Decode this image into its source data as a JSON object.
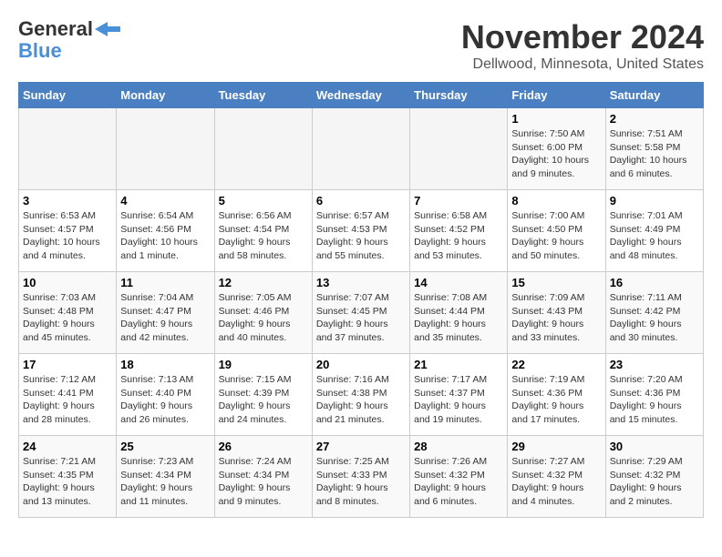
{
  "header": {
    "logo_line1": "General",
    "logo_line2": "Blue",
    "month": "November 2024",
    "location": "Dellwood, Minnesota, United States"
  },
  "days_of_week": [
    "Sunday",
    "Monday",
    "Tuesday",
    "Wednesday",
    "Thursday",
    "Friday",
    "Saturday"
  ],
  "weeks": [
    [
      {
        "day": "",
        "info": ""
      },
      {
        "day": "",
        "info": ""
      },
      {
        "day": "",
        "info": ""
      },
      {
        "day": "",
        "info": ""
      },
      {
        "day": "",
        "info": ""
      },
      {
        "day": "1",
        "info": "Sunrise: 7:50 AM\nSunset: 6:00 PM\nDaylight: 10 hours and 9 minutes."
      },
      {
        "day": "2",
        "info": "Sunrise: 7:51 AM\nSunset: 5:58 PM\nDaylight: 10 hours and 6 minutes."
      }
    ],
    [
      {
        "day": "3",
        "info": "Sunrise: 6:53 AM\nSunset: 4:57 PM\nDaylight: 10 hours and 4 minutes."
      },
      {
        "day": "4",
        "info": "Sunrise: 6:54 AM\nSunset: 4:56 PM\nDaylight: 10 hours and 1 minute."
      },
      {
        "day": "5",
        "info": "Sunrise: 6:56 AM\nSunset: 4:54 PM\nDaylight: 9 hours and 58 minutes."
      },
      {
        "day": "6",
        "info": "Sunrise: 6:57 AM\nSunset: 4:53 PM\nDaylight: 9 hours and 55 minutes."
      },
      {
        "day": "7",
        "info": "Sunrise: 6:58 AM\nSunset: 4:52 PM\nDaylight: 9 hours and 53 minutes."
      },
      {
        "day": "8",
        "info": "Sunrise: 7:00 AM\nSunset: 4:50 PM\nDaylight: 9 hours and 50 minutes."
      },
      {
        "day": "9",
        "info": "Sunrise: 7:01 AM\nSunset: 4:49 PM\nDaylight: 9 hours and 48 minutes."
      }
    ],
    [
      {
        "day": "10",
        "info": "Sunrise: 7:03 AM\nSunset: 4:48 PM\nDaylight: 9 hours and 45 minutes."
      },
      {
        "day": "11",
        "info": "Sunrise: 7:04 AM\nSunset: 4:47 PM\nDaylight: 9 hours and 42 minutes."
      },
      {
        "day": "12",
        "info": "Sunrise: 7:05 AM\nSunset: 4:46 PM\nDaylight: 9 hours and 40 minutes."
      },
      {
        "day": "13",
        "info": "Sunrise: 7:07 AM\nSunset: 4:45 PM\nDaylight: 9 hours and 37 minutes."
      },
      {
        "day": "14",
        "info": "Sunrise: 7:08 AM\nSunset: 4:44 PM\nDaylight: 9 hours and 35 minutes."
      },
      {
        "day": "15",
        "info": "Sunrise: 7:09 AM\nSunset: 4:43 PM\nDaylight: 9 hours and 33 minutes."
      },
      {
        "day": "16",
        "info": "Sunrise: 7:11 AM\nSunset: 4:42 PM\nDaylight: 9 hours and 30 minutes."
      }
    ],
    [
      {
        "day": "17",
        "info": "Sunrise: 7:12 AM\nSunset: 4:41 PM\nDaylight: 9 hours and 28 minutes."
      },
      {
        "day": "18",
        "info": "Sunrise: 7:13 AM\nSunset: 4:40 PM\nDaylight: 9 hours and 26 minutes."
      },
      {
        "day": "19",
        "info": "Sunrise: 7:15 AM\nSunset: 4:39 PM\nDaylight: 9 hours and 24 minutes."
      },
      {
        "day": "20",
        "info": "Sunrise: 7:16 AM\nSunset: 4:38 PM\nDaylight: 9 hours and 21 minutes."
      },
      {
        "day": "21",
        "info": "Sunrise: 7:17 AM\nSunset: 4:37 PM\nDaylight: 9 hours and 19 minutes."
      },
      {
        "day": "22",
        "info": "Sunrise: 7:19 AM\nSunset: 4:36 PM\nDaylight: 9 hours and 17 minutes."
      },
      {
        "day": "23",
        "info": "Sunrise: 7:20 AM\nSunset: 4:36 PM\nDaylight: 9 hours and 15 minutes."
      }
    ],
    [
      {
        "day": "24",
        "info": "Sunrise: 7:21 AM\nSunset: 4:35 PM\nDaylight: 9 hours and 13 minutes."
      },
      {
        "day": "25",
        "info": "Sunrise: 7:23 AM\nSunset: 4:34 PM\nDaylight: 9 hours and 11 minutes."
      },
      {
        "day": "26",
        "info": "Sunrise: 7:24 AM\nSunset: 4:34 PM\nDaylight: 9 hours and 9 minutes."
      },
      {
        "day": "27",
        "info": "Sunrise: 7:25 AM\nSunset: 4:33 PM\nDaylight: 9 hours and 8 minutes."
      },
      {
        "day": "28",
        "info": "Sunrise: 7:26 AM\nSunset: 4:32 PM\nDaylight: 9 hours and 6 minutes."
      },
      {
        "day": "29",
        "info": "Sunrise: 7:27 AM\nSunset: 4:32 PM\nDaylight: 9 hours and 4 minutes."
      },
      {
        "day": "30",
        "info": "Sunrise: 7:29 AM\nSunset: 4:32 PM\nDaylight: 9 hours and 2 minutes."
      }
    ]
  ]
}
